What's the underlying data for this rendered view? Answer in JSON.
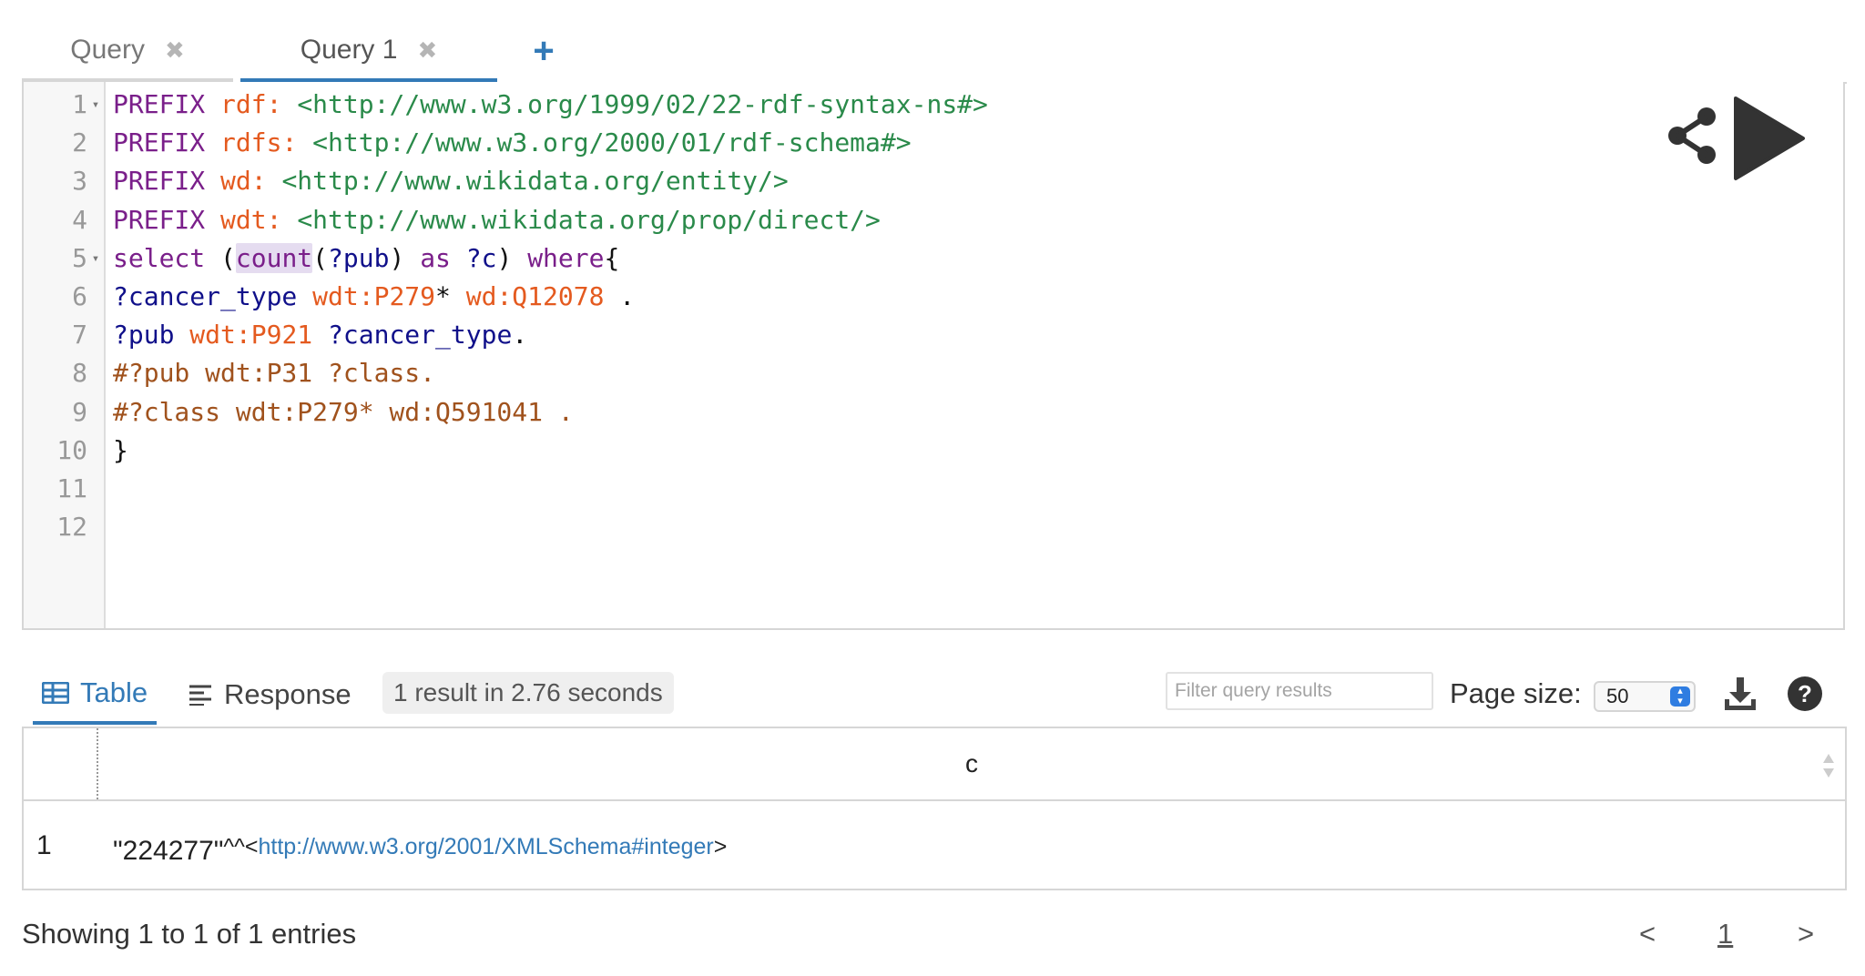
{
  "query_tabs": [
    {
      "label": "Query",
      "active": false
    },
    {
      "label": "Query 1",
      "active": true
    }
  ],
  "close_glyph": "✖",
  "add_tab_glyph": "+",
  "editor": {
    "lines": [
      {
        "n": "1",
        "fold": "▾",
        "tokens": [
          {
            "t": "PREFIX ",
            "c": "kw"
          },
          {
            "t": "rdf: ",
            "c": "pf"
          },
          {
            "t": "<http://www.w3.org/1999/02/22-rdf-syntax-ns#>",
            "c": "ur"
          }
        ]
      },
      {
        "n": "2",
        "fold": "",
        "tokens": [
          {
            "t": "PREFIX ",
            "c": "kw"
          },
          {
            "t": "rdfs: ",
            "c": "pf"
          },
          {
            "t": "<http://www.w3.org/2000/01/rdf-schema#>",
            "c": "ur"
          }
        ]
      },
      {
        "n": "3",
        "fold": "",
        "tokens": [
          {
            "t": "PREFIX ",
            "c": "kw"
          },
          {
            "t": "wd: ",
            "c": "pf"
          },
          {
            "t": "<http://www.wikidata.org/entity/>",
            "c": "ur"
          }
        ]
      },
      {
        "n": "4",
        "fold": "",
        "tokens": [
          {
            "t": "PREFIX ",
            "c": "kw"
          },
          {
            "t": "wdt: ",
            "c": "pf"
          },
          {
            "t": "<http://www.wikidata.org/prop/direct/>",
            "c": "ur"
          }
        ]
      },
      {
        "n": "5",
        "fold": "▾",
        "tokens": [
          {
            "t": "select ",
            "c": "kw"
          },
          {
            "t": "(",
            "c": "tx"
          },
          {
            "t": "count",
            "c": "kw hl"
          },
          {
            "t": "(",
            "c": "tx"
          },
          {
            "t": "?pub",
            "c": "va"
          },
          {
            "t": ") ",
            "c": "tx"
          },
          {
            "t": "as ",
            "c": "kw"
          },
          {
            "t": "?c",
            "c": "va"
          },
          {
            "t": ") ",
            "c": "tx"
          },
          {
            "t": "where",
            "c": "kw"
          },
          {
            "t": "{",
            "c": "tx"
          }
        ]
      },
      {
        "n": "6",
        "fold": "",
        "tokens": [
          {
            "t": "?cancer_type ",
            "c": "va"
          },
          {
            "t": "wdt:P279",
            "c": "pf"
          },
          {
            "t": "* ",
            "c": "tx"
          },
          {
            "t": "wd:Q12078",
            "c": "pf"
          },
          {
            "t": " .",
            "c": "tx"
          }
        ]
      },
      {
        "n": "7",
        "fold": "",
        "tokens": [
          {
            "t": "?pub ",
            "c": "va"
          },
          {
            "t": "wdt:P921 ",
            "c": "pf"
          },
          {
            "t": "?cancer_type",
            "c": "va"
          },
          {
            "t": ".",
            "c": "tx"
          }
        ]
      },
      {
        "n": "8",
        "fold": "",
        "tokens": [
          {
            "t": "#?pub wdt:P31 ?class.",
            "c": "cm"
          }
        ]
      },
      {
        "n": "9",
        "fold": "",
        "tokens": [
          {
            "t": "#?class wdt:P279* wd:Q591041 .",
            "c": "cm"
          }
        ]
      },
      {
        "n": "10",
        "fold": "",
        "tokens": [
          {
            "t": "}",
            "c": "tx"
          }
        ]
      },
      {
        "n": "11",
        "fold": "",
        "tokens": []
      },
      {
        "n": "12",
        "fold": "",
        "tokens": []
      }
    ]
  },
  "results": {
    "tab_table": "Table",
    "tab_response": "Response",
    "status": "1 result in 2.76 seconds",
    "filter_placeholder": "Filter query results",
    "page_size_label": "Page size:",
    "page_size_value": "50",
    "column_header": "c",
    "rows": [
      {
        "index": "1",
        "literal": "\"224277\"",
        "datatype_sep": "^^<",
        "datatype_link": "http://www.w3.org/2001/XMLSchema#integer",
        "closing": ">"
      }
    ],
    "showing": "Showing 1 to 1 of 1 entries",
    "pager_prev": "<",
    "pager_page": "1",
    "pager_next": ">"
  },
  "icons": {
    "share": "share-icon",
    "run": "play-icon",
    "table": "table-icon",
    "response": "lines-icon",
    "download": "download-icon",
    "help": "help-icon"
  },
  "colors": {
    "accent": "#337ab7",
    "keyword": "#7a1f8a",
    "prefix": "#e45a1f",
    "uri": "#2a8a4a",
    "variable": "#10108a",
    "comment": "#a0521d"
  }
}
